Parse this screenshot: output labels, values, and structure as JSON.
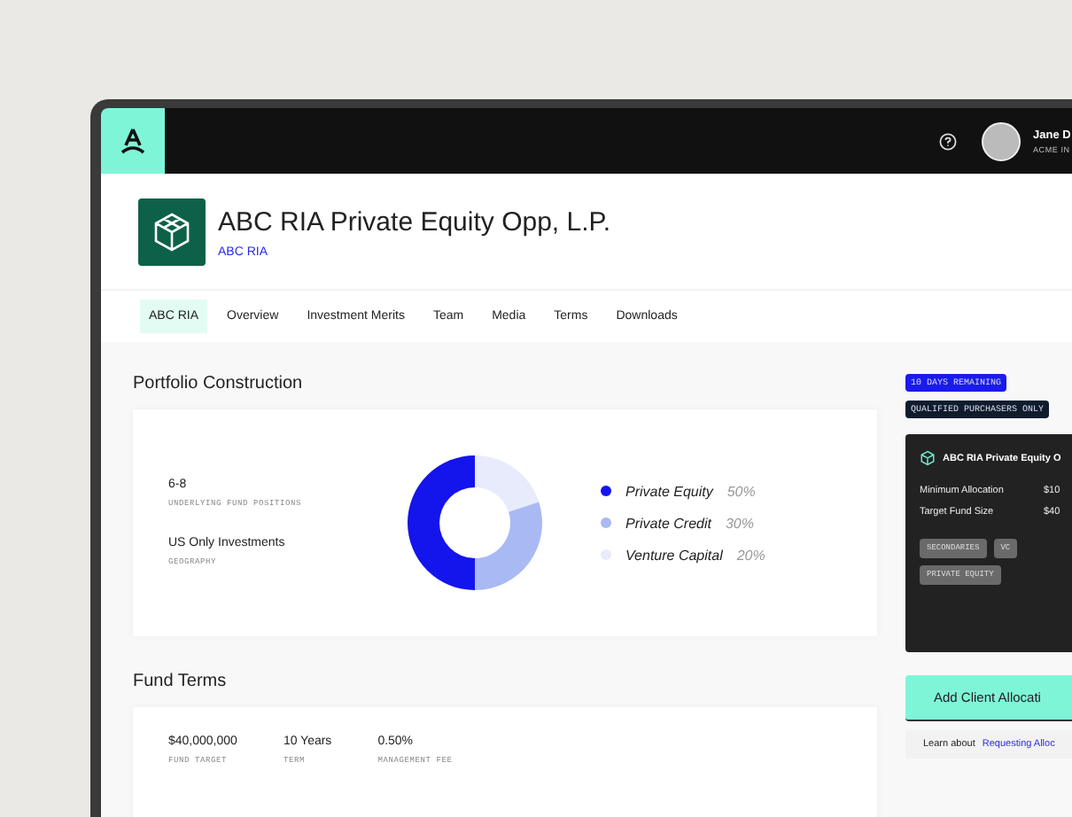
{
  "topbar": {
    "user_name": "Jane D",
    "user_org": "ACME IN"
  },
  "fund": {
    "title": "ABC RIA Private Equity Opp, L.P.",
    "sponsor": "ABC RIA"
  },
  "tabs": [
    {
      "label": "ABC RIA",
      "selected": true
    },
    {
      "label": "Overview",
      "selected": false
    },
    {
      "label": "Investment Merits",
      "selected": false
    },
    {
      "label": "Team",
      "selected": false
    },
    {
      "label": "Media",
      "selected": false
    },
    {
      "label": "Terms",
      "selected": false
    },
    {
      "label": "Downloads",
      "selected": false
    }
  ],
  "portfolio": {
    "title": "Portfolio Construction",
    "stats": [
      {
        "value": "6-8",
        "label": "UNDERLYING FUND POSITIONS"
      },
      {
        "value": "US Only Investments",
        "label": "GEOGRAPHY"
      }
    ],
    "legend": [
      {
        "share": "50%",
        "color": "#1414ec"
      },
      {
        "share": "30%",
        "color": "#a9b9f3"
      },
      {
        "share": "20%",
        "color": "#e8ebfb"
      }
    ],
    "chart_data": {
      "type": "donut",
      "categories": [
        "Private Equity",
        "Private Credit",
        "Venture Capital"
      ],
      "values": [
        50,
        30,
        20
      ]
    }
  },
  "fund_terms": {
    "title": "Fund Terms",
    "items": [
      {
        "value": "$40,000,000",
        "label": "FUND TARGET"
      },
      {
        "value": "10 Years",
        "label": "TERM"
      },
      {
        "value": "0.50%",
        "label": "MANAGEMENT FEE"
      }
    ]
  },
  "sidebar": {
    "badges": [
      {
        "text": "10 DAYS REMAINING",
        "kind": "countdown"
      },
      {
        "text": "QUALIFIED PURCHASERS ONLY",
        "kind": "eligibility"
      }
    ],
    "card": {
      "title": "ABC RIA Private Equity O",
      "rows": [
        {
          "label": "Minimum Allocation",
          "value": "$10"
        },
        {
          "label": "Target Fund Size",
          "value": "$40"
        }
      ],
      "tags": [
        "SECONDARIES",
        "VC",
        "PRIVATE EQUITY"
      ]
    },
    "button": "Add Client Allocati",
    "learn_text": "Learn about",
    "learn_link": "Requesting Alloc"
  }
}
